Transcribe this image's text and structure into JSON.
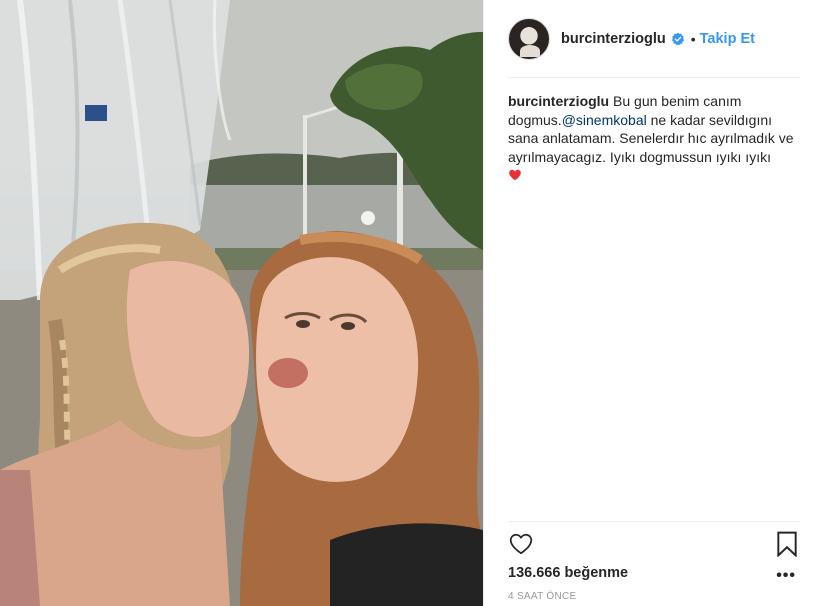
{
  "post": {
    "image": {
      "alt_icon": "photo-image",
      "colors": {
        "sky": "#c4c6c1",
        "water": "#a7aaa4",
        "hills": "#58624f",
        "trees": "#3f5a2e",
        "hair_left": "#c4a27a",
        "hair_right": "#a86a3f",
        "skin": "#e9b9a1"
      }
    }
  },
  "header": {
    "username": "burcinterzioglu",
    "verified_icon": "verified-badge-icon",
    "separator": "•",
    "follow_label": "Takip Et"
  },
  "caption": {
    "username": "burcinterzioglu",
    "text_before_mention": "Bu gun benim canım dogmus.",
    "mention": "@sinemkobal",
    "text_after_mention": " ne kadar sevildıgını sana anlatamam. Senelerdır hıc ayrılmadık ve ayrılmayacagız. Iyıkı dogmussun ıyıkı ıyıkı",
    "emoji_icon": "red-heart-emoji"
  },
  "actions": {
    "like_icon": "heart-outline-icon",
    "save_icon": "bookmark-icon",
    "more_icon": "more-options-icon",
    "more_label": "•••"
  },
  "stats": {
    "likes_label": "136.666 beğenme"
  },
  "meta": {
    "timestamp": "4 SAAT ÖNCE"
  },
  "colors": {
    "link_blue": "#3897f0",
    "mention_blue": "#003569",
    "text": "#262626",
    "muted": "#999999",
    "divider": "#efefef",
    "heart_red": "#e8323a"
  }
}
